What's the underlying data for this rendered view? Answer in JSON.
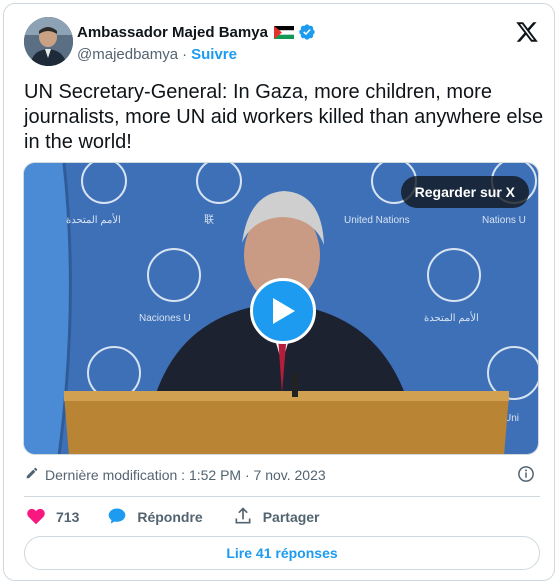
{
  "author": {
    "name": "Ambassador Majed Bamya",
    "handle": "@majedbamya",
    "separator": "·",
    "follow_label": "Suivre"
  },
  "tweet": {
    "text": "UN Secretary-General: In Gaza, more children, more journalists, more UN aid workers killed than anywhere else in the world!"
  },
  "media": {
    "watch_label": "Regarder sur X"
  },
  "meta": {
    "timestamp": "Dernière modification : 1:52 PM · 7 nov. 2023"
  },
  "actions": {
    "likes": "713",
    "reply_label": "Répondre",
    "share_label": "Partager"
  },
  "footer": {
    "read_replies_label": "Lire 41 réponses"
  },
  "colors": {
    "accent": "#1d9bf0",
    "like": "#f91880",
    "un_blue": "#3e70b8"
  },
  "icons": [
    "x-logo-icon",
    "verified-badge-icon",
    "palestine-flag-icon",
    "play-icon",
    "pencil-icon",
    "info-icon",
    "heart-icon",
    "reply-bubble-icon",
    "share-icon"
  ]
}
